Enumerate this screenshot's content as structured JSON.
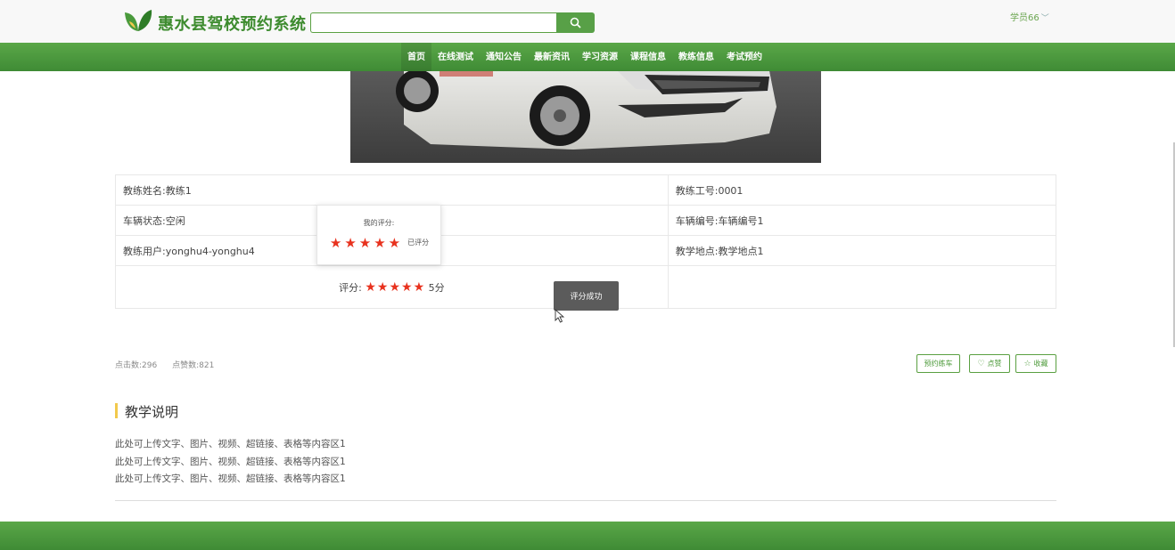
{
  "header": {
    "site_title": "惠水县驾校预约系统",
    "search_placeholder": "",
    "user_label": "学员66"
  },
  "nav": {
    "items": [
      "首页",
      "在线测试",
      "通知公告",
      "最新资讯",
      "学习资源",
      "课程信息",
      "教练信息",
      "考试预约"
    ],
    "active_index": 0
  },
  "details": {
    "coach_name": "教练姓名:教练1",
    "coach_id": "教练工号:0001",
    "vehicle_status": "车辆状态:空闲",
    "vehicle_number": "车辆编号:车辆编号1",
    "coach_user": "教练用户:yonghu4-yonghu4",
    "teaching_location": "教学地点:教学地点1",
    "rating_label": "评分:",
    "rating_value": 5,
    "rating_text": "5分"
  },
  "popover": {
    "title": "我的评分:",
    "rating_value": 5,
    "status": "已评分"
  },
  "toast": {
    "message": "评分成功"
  },
  "stats": {
    "clicks": "点击数:296",
    "likes": "点赞数:821"
  },
  "actions": {
    "book": "预约练车",
    "like": "点赞",
    "favorite": "收藏"
  },
  "section": {
    "title": "教学说明",
    "lines": [
      "此处可上传文字、图片、视频、超链接、表格等内容区1",
      "此处可上传文字、图片、视频、超链接、表格等内容区1",
      "此处可上传文字、图片、视频、超链接、表格等内容区1"
    ]
  },
  "colors": {
    "brand_green": "#4a9a3c",
    "star_red": "#e8321e",
    "section_accent": "#f2c94c"
  }
}
